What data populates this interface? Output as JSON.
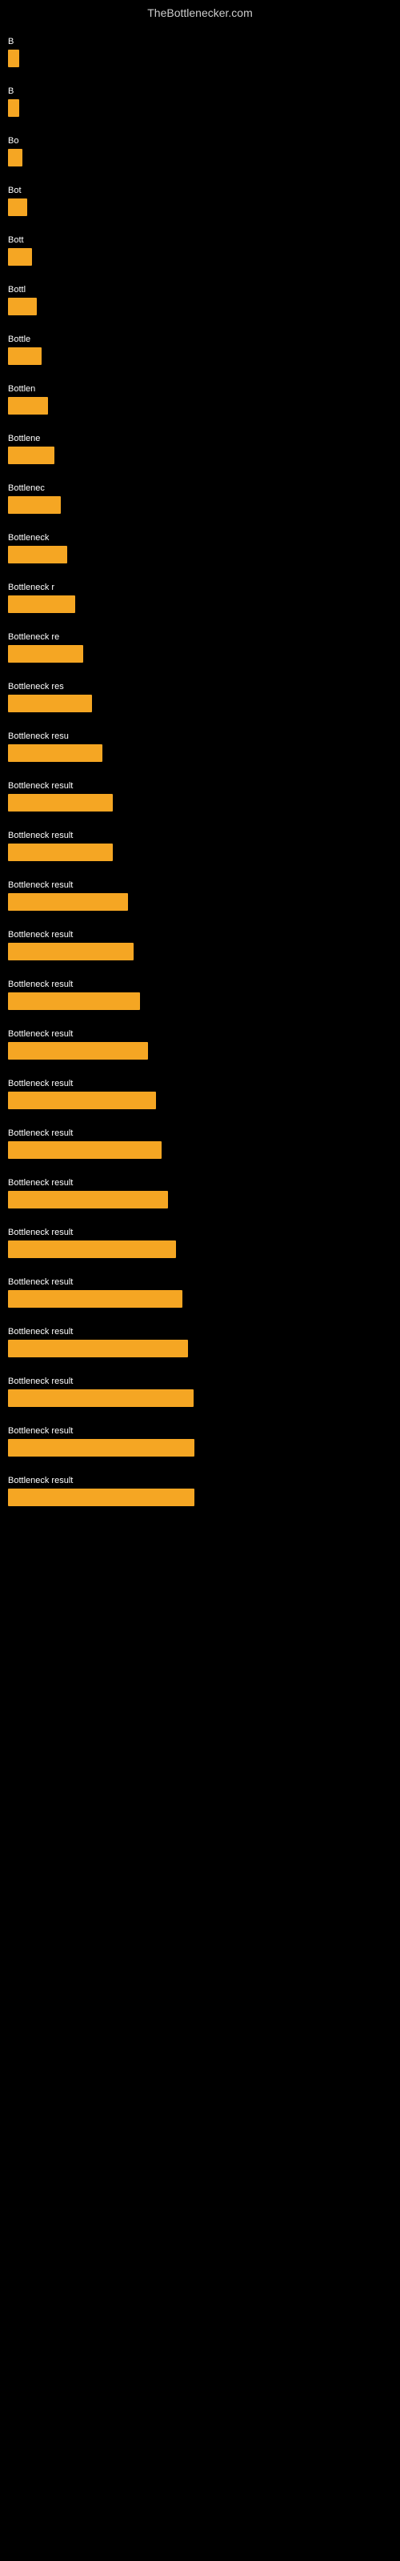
{
  "header": {
    "title": "TheBottlenecker.com"
  },
  "bars": [
    {
      "label": "B",
      "widthPx": 14,
      "widthPct": 2.9
    },
    {
      "label": "B",
      "widthPx": 14,
      "widthPct": 2.9
    },
    {
      "label": "Bo",
      "widthPx": 18,
      "widthPct": 3.8
    },
    {
      "label": "Bot",
      "widthPx": 24,
      "widthPct": 5.0
    },
    {
      "label": "Bott",
      "widthPx": 30,
      "widthPct": 6.3
    },
    {
      "label": "Bottl",
      "widthPx": 36,
      "widthPct": 7.5
    },
    {
      "label": "Bottle",
      "widthPx": 42,
      "widthPct": 8.8
    },
    {
      "label": "Bottlen",
      "widthPx": 50,
      "widthPct": 10.4
    },
    {
      "label": "Bottlene",
      "widthPx": 58,
      "widthPct": 12.1
    },
    {
      "label": "Bottlenec",
      "widthPx": 66,
      "widthPct": 13.8
    },
    {
      "label": "Bottleneck",
      "widthPx": 74,
      "widthPct": 15.4
    },
    {
      "label": "Bottleneck r",
      "widthPx": 84,
      "widthPct": 17.5
    },
    {
      "label": "Bottleneck re",
      "widthPx": 94,
      "widthPct": 19.6
    },
    {
      "label": "Bottleneck res",
      "widthPx": 105,
      "widthPct": 21.9
    },
    {
      "label": "Bottleneck resu",
      "widthPx": 118,
      "widthPct": 24.6
    },
    {
      "label": "Bottleneck result",
      "widthPx": 131,
      "widthPct": 27.3
    },
    {
      "label": "Bottleneck result",
      "widthPx": 131,
      "widthPct": 27.3
    },
    {
      "label": "Bottleneck result",
      "widthPx": 150,
      "widthPct": 31.3
    },
    {
      "label": "Bottleneck result",
      "widthPx": 157,
      "widthPct": 32.7
    },
    {
      "label": "Bottleneck result",
      "widthPx": 165,
      "widthPct": 34.4
    },
    {
      "label": "Bottleneck result",
      "widthPx": 175,
      "widthPct": 36.5
    },
    {
      "label": "Bottleneck result",
      "widthPx": 185,
      "widthPct": 38.5
    },
    {
      "label": "Bottleneck result",
      "widthPx": 192,
      "widthPct": 40.0
    },
    {
      "label": "Bottleneck result",
      "widthPx": 200,
      "widthPct": 41.7
    },
    {
      "label": "Bottleneck result",
      "widthPx": 210,
      "widthPct": 43.8
    },
    {
      "label": "Bottleneck result",
      "widthPx": 218,
      "widthPct": 45.4
    },
    {
      "label": "Bottleneck result",
      "widthPx": 225,
      "widthPct": 46.9
    },
    {
      "label": "Bottleneck result",
      "widthPx": 232,
      "widthPct": 48.3
    },
    {
      "label": "Bottleneck result",
      "widthPx": 233,
      "widthPct": 48.5
    },
    {
      "label": "Bottleneck result",
      "widthPx": 233,
      "widthPct": 48.5
    }
  ]
}
